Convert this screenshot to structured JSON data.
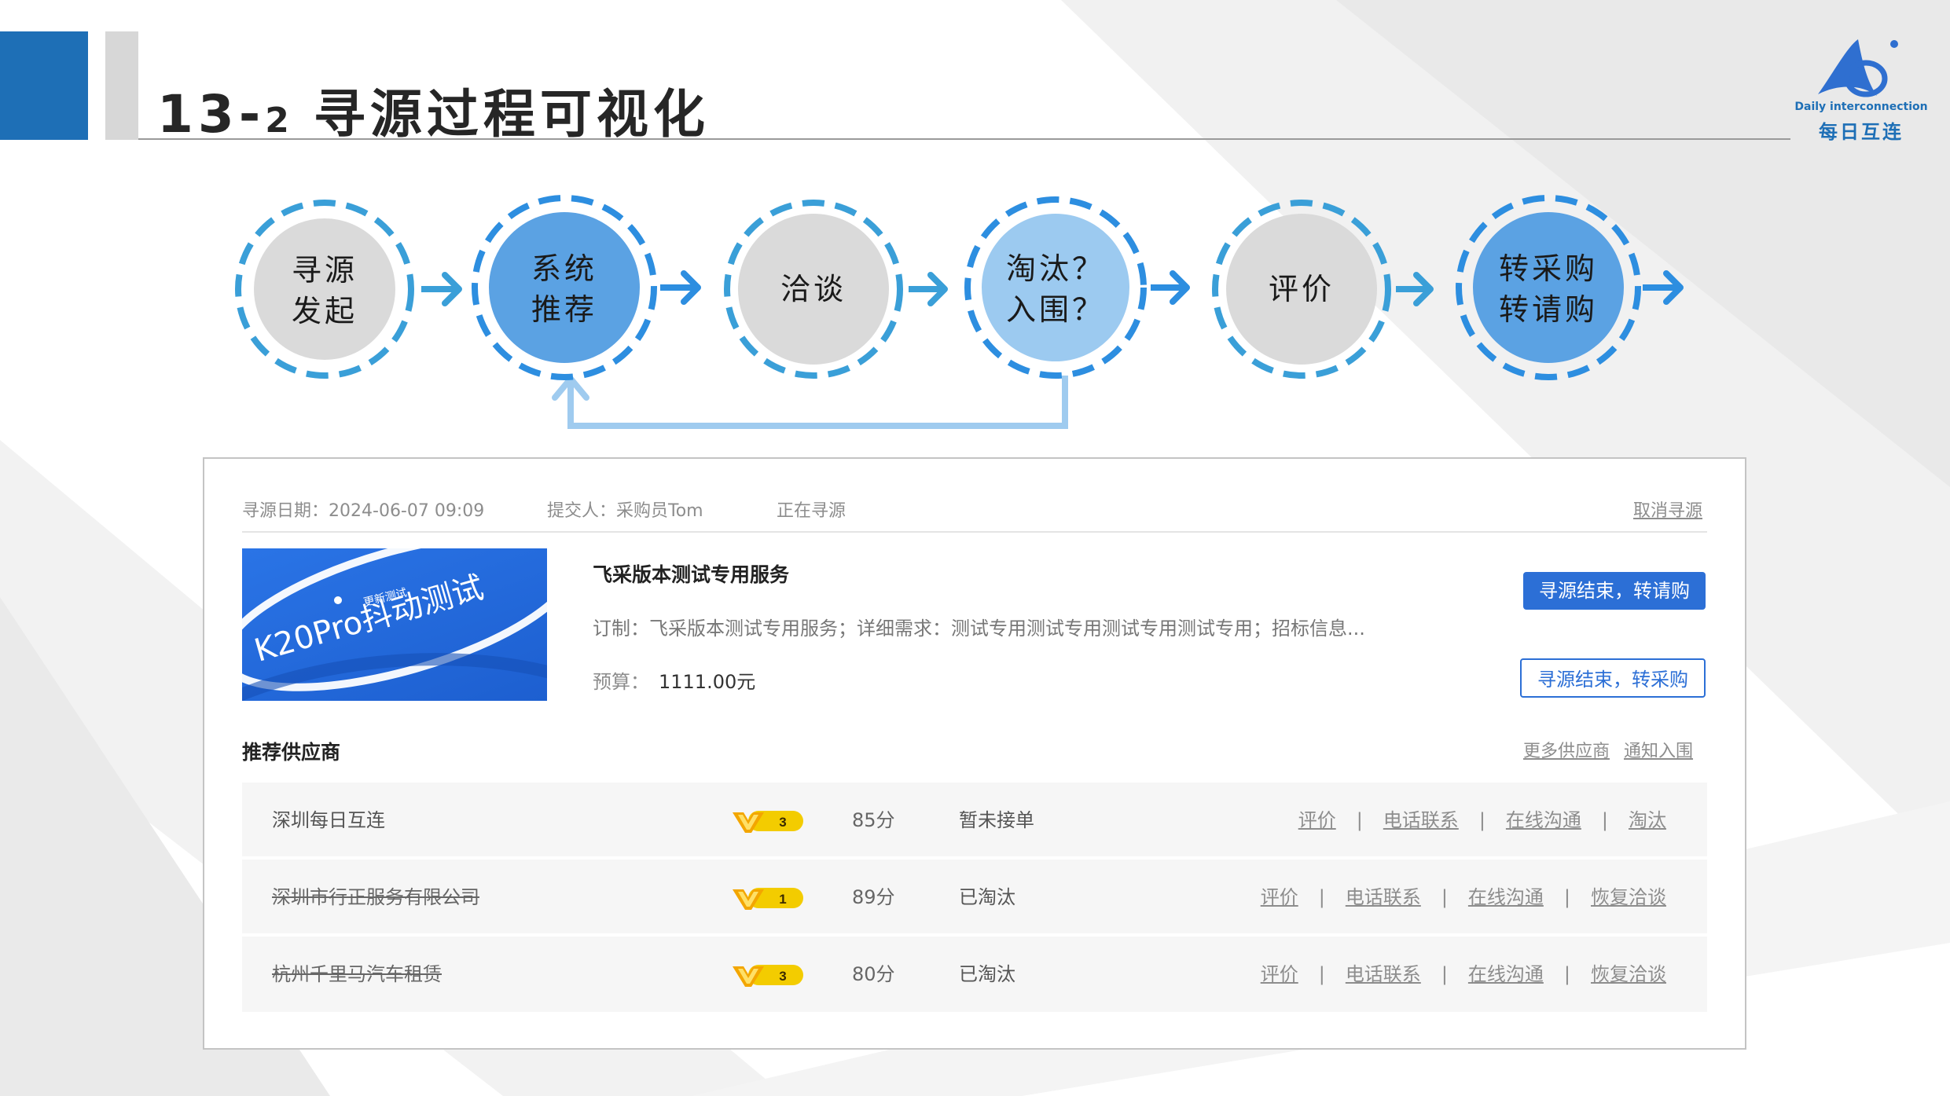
{
  "header": {
    "title_num": "13-",
    "title_sub": "2",
    "title_text": "寻源过程可视化",
    "logo_en": "Daily interconnection",
    "logo_cn": "每日互连",
    "colors": {
      "brand_blue": "#1e6fb6",
      "accent_gray": "#d7d7d7"
    }
  },
  "flow": {
    "steps": [
      {
        "line1": "寻源",
        "line2": "发起",
        "style": "gray"
      },
      {
        "line1": "系统",
        "line2": "推荐",
        "style": "blue"
      },
      {
        "line1": "洽谈",
        "line2": "",
        "style": "gray"
      },
      {
        "line1": "淘汰？",
        "line2": "入围？",
        "style": "light-blue"
      },
      {
        "line1": "评价",
        "line2": "",
        "style": "gray"
      },
      {
        "line1": "转采购",
        "line2": "转请购",
        "style": "blue"
      }
    ],
    "colors": {
      "ring": "#3a9fd8",
      "arrow": "#2d8ee0",
      "fill_gray": "#dadada",
      "fill_blue": "#5ba2e3",
      "fill_light": "#9ccaf0",
      "loop": "#9fcbef"
    }
  },
  "sourcing": {
    "date_label": "寻源日期：",
    "date_value": "2024-06-07 09:09",
    "submitter_label": "提交人：",
    "submitter_value": "采购员Tom",
    "status": "正在寻源",
    "cancel_label": "取消寻源"
  },
  "product": {
    "image_caption": "更新测试",
    "image_text": "K20Pro抖动测试",
    "title": "飞采版本测试专用服务",
    "description": "订制：飞采版本测试专用服务；详细需求：测试专用测试专用测试专用测试专用；招标信息...",
    "budget_label": "预算：",
    "budget_value": "1111.00元"
  },
  "actions": {
    "to_requisition": "寻源结束，转请购",
    "to_purchase": "寻源结束，转采购"
  },
  "suppliers": {
    "title": "推荐供应商",
    "more_label": "更多供应商",
    "notify_label": "通知入围",
    "rows": [
      {
        "name": "深圳每日互连",
        "level": "3",
        "score": "85分",
        "status": "暂未接单",
        "struck": false,
        "actions": [
          "评价",
          "电话联系",
          "在线沟通",
          "淘汰"
        ]
      },
      {
        "name": "深圳市行正服务有限公司",
        "level": "1",
        "score": "89分",
        "status": "已淘汰",
        "struck": true,
        "actions": [
          "评价",
          "电话联系",
          "在线沟通",
          "恢复洽谈"
        ]
      },
      {
        "name": "杭州千里马汽车租赁",
        "level": "3",
        "score": "80分",
        "status": "已淘汰",
        "struck": true,
        "actions": [
          "评价",
          "电话联系",
          "在线沟通",
          "恢复洽谈"
        ]
      }
    ]
  }
}
